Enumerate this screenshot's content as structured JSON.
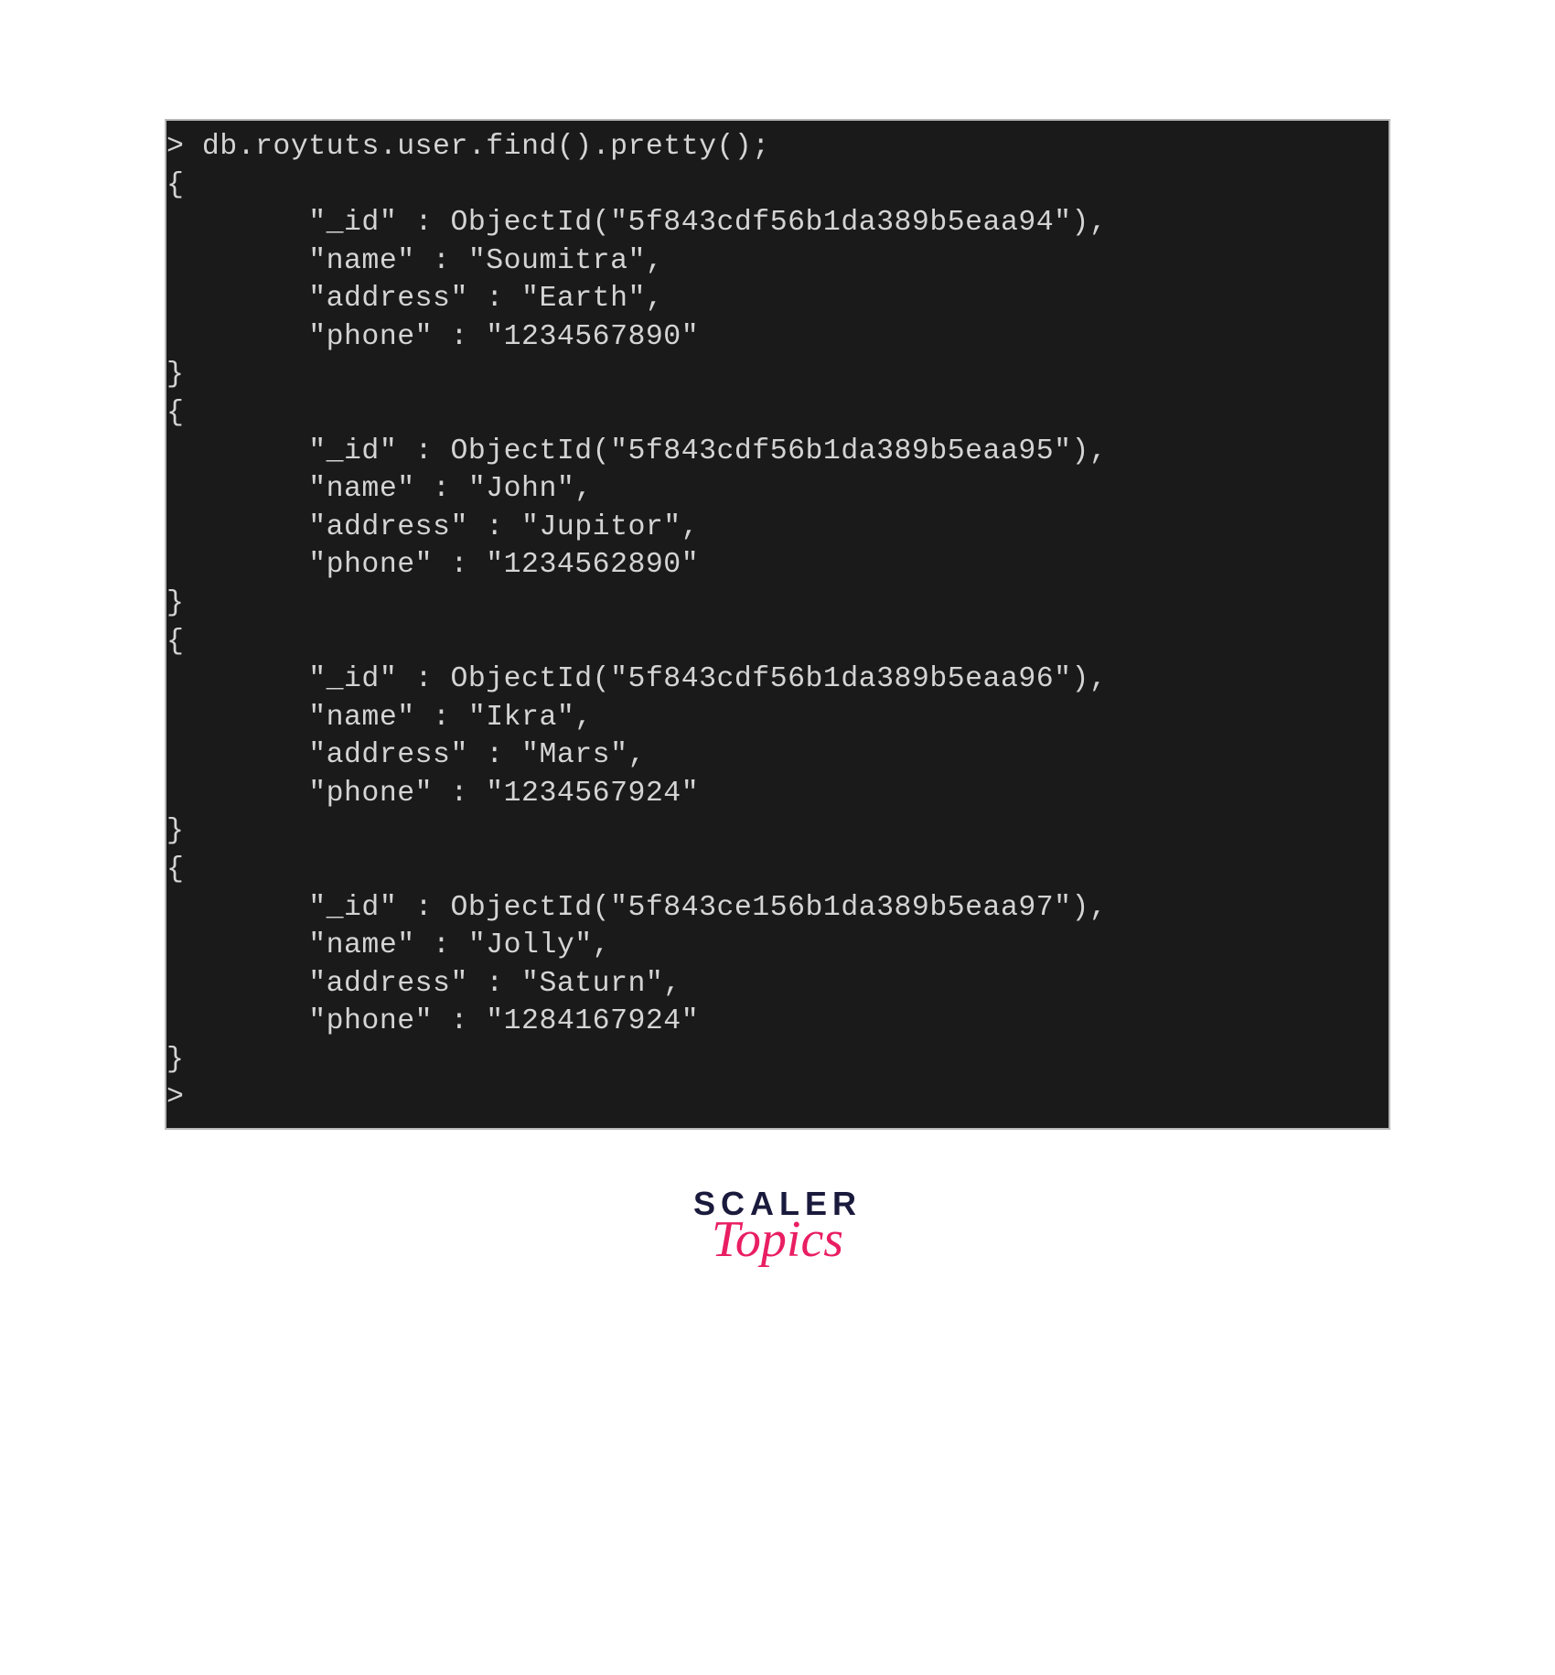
{
  "terminal": {
    "prompt_char": ">",
    "command": "db.roytuts.user.find().pretty();",
    "open_brace": "{",
    "close_brace": "}",
    "end_prompt": ">",
    "records": [
      {
        "id_line": "        \"_id\" : ObjectId(\"5f843cdf56b1da389b5eaa94\"),",
        "name_line": "        \"name\" : \"Soumitra\",",
        "address_line": "        \"address\" : \"Earth\",",
        "phone_line": "        \"phone\" : \"1234567890\""
      },
      {
        "id_line": "        \"_id\" : ObjectId(\"5f843cdf56b1da389b5eaa95\"),",
        "name_line": "        \"name\" : \"John\",",
        "address_line": "        \"address\" : \"Jupitor\",",
        "phone_line": "        \"phone\" : \"1234562890\""
      },
      {
        "id_line": "        \"_id\" : ObjectId(\"5f843cdf56b1da389b5eaa96\"),",
        "name_line": "        \"name\" : \"Ikra\",",
        "address_line": "        \"address\" : \"Mars\",",
        "phone_line": "        \"phone\" : \"1234567924\""
      },
      {
        "id_line": "        \"_id\" : ObjectId(\"5f843ce156b1da389b5eaa97\"),",
        "name_line": "        \"name\" : \"Jolly\",",
        "address_line": "        \"address\" : \"Saturn\",",
        "phone_line": "        \"phone\" : \"1284167924\""
      }
    ]
  },
  "logo": {
    "line1": "SCALER",
    "line2": "Topics"
  }
}
